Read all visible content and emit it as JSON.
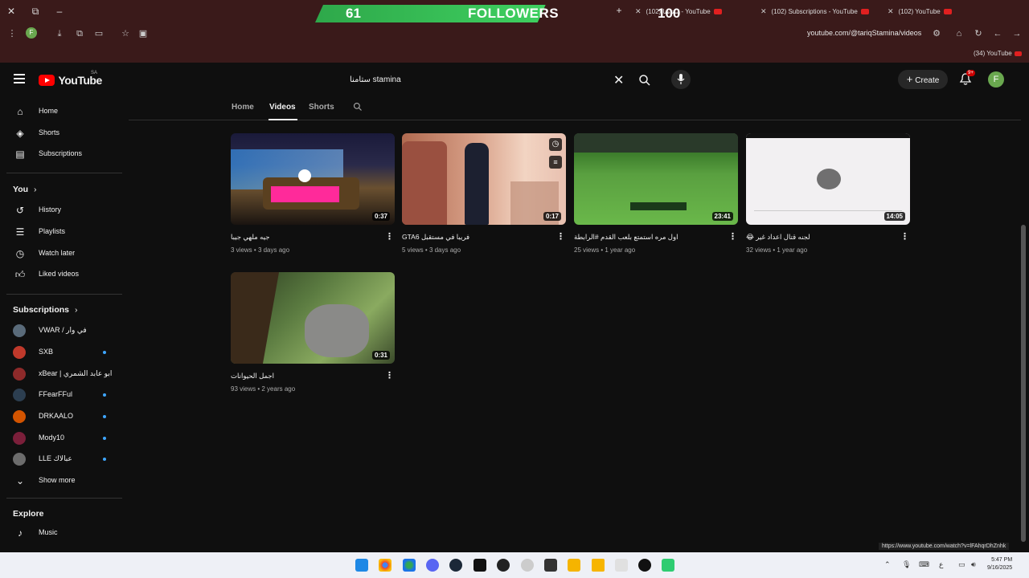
{
  "browser": {
    "followers_overlay": {
      "current": "61",
      "label": "FOLLOWERS",
      "goal": "100",
      "progress": 0.61
    },
    "tabs": [
      {
        "label": "(102) ستامنا - YouTube"
      },
      {
        "label": "(102) Subscriptions - YouTube"
      },
      {
        "label": "(102) YouTube"
      }
    ],
    "address_bar": {
      "url": "youtube.com/@tariqStamina/videos",
      "profile_letter": "F"
    },
    "bookmark": {
      "label": "(34) YouTube"
    }
  },
  "header": {
    "logo_text": "YouTube",
    "country_code": "SA",
    "search_value": "ستامنا stamina",
    "create_label": "Create",
    "notifications_badge": "9+",
    "avatar_letter": "F"
  },
  "sidebar": {
    "main": [
      {
        "label": "Home",
        "icon": "home-icon"
      },
      {
        "label": "Shorts",
        "icon": "shorts-icon"
      },
      {
        "label": "Subscriptions",
        "icon": "subscriptions-icon"
      }
    ],
    "you_heading": "You",
    "you_items": [
      {
        "label": "History",
        "icon": "history-icon"
      },
      {
        "label": "Playlists",
        "icon": "playlists-icon"
      },
      {
        "label": "Watch later",
        "icon": "watch-later-icon"
      },
      {
        "label": "Liked videos",
        "icon": "liked-icon"
      }
    ],
    "subscriptions_heading": "Subscriptions",
    "subscriptions": [
      {
        "label": "VWAR / في وار",
        "color": "#5a6b7a",
        "dot": false
      },
      {
        "label": "SXB",
        "color": "#c0392b",
        "dot": true
      },
      {
        "label": "xBear | ابو عابد الشمري",
        "color": "#8e2a2a",
        "dot": false
      },
      {
        "label": "FFearFFul",
        "color": "#2c3e50",
        "dot": true
      },
      {
        "label": "DRKAALO",
        "color": "#d35400",
        "dot": true
      },
      {
        "label": "Mody10",
        "color": "#7b1f3a",
        "dot": true
      },
      {
        "label": "LLE عبالاك",
        "color": "#6c6c6c",
        "dot": true
      }
    ],
    "show_more": "Show more",
    "explore_heading": "Explore",
    "explore_items": [
      {
        "label": "Music",
        "icon": "music-icon"
      }
    ]
  },
  "channel_tabs": {
    "items": [
      "Home",
      "Videos",
      "Shorts"
    ],
    "active": "Videos"
  },
  "videos": [
    {
      "title": "جيه ملهي جيبا",
      "views": "3 views",
      "age": "3 days ago",
      "duration": "0:37"
    },
    {
      "title": "GTA6 فريبا في مستقبل",
      "views": "5 views",
      "age": "3 days ago",
      "duration": "0:17"
    },
    {
      "title": "اول مره استمتع بلعب القدم #الرابطة",
      "views": "25 views",
      "age": "1 year ago",
      "duration": "23:41"
    },
    {
      "title": "😂 لجنه قتال اعداد غير",
      "views": "32 views",
      "age": "1 year ago",
      "duration": "14:05"
    },
    {
      "title": "اجمل الحيوانات",
      "views": "93 views",
      "age": "2 years ago",
      "duration": "0:31"
    }
  ],
  "status_url": "https://www.youtube.com/watch?v=lFAhqrDhZnhk",
  "taskbar": {
    "time": "5:47 PM",
    "date": "9/16/2025"
  }
}
